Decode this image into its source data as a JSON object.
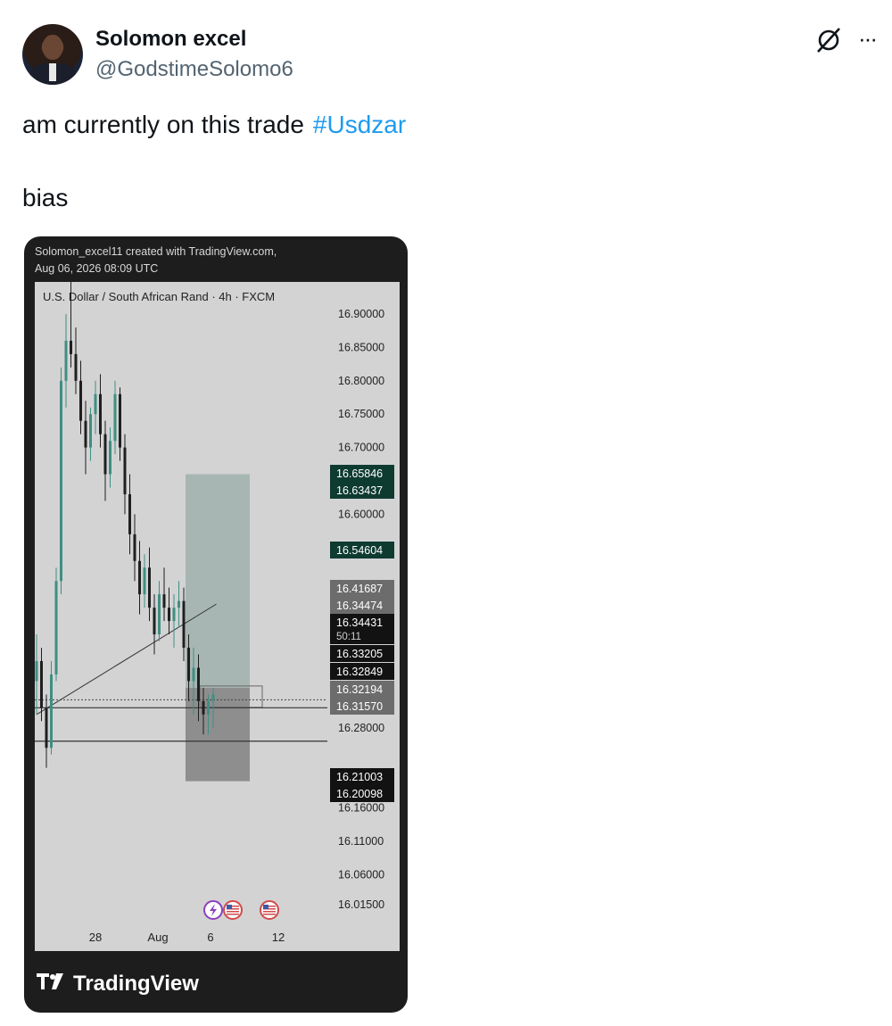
{
  "author": {
    "name": "Solomon excel",
    "handle": "@GodstimeSolomo6"
  },
  "tweet": {
    "text": "am currently on this trade",
    "hashtag": "#Usdzar",
    "second_line": "bias"
  },
  "icons": {
    "grok": "grok-icon",
    "more": "more-icon"
  },
  "chart_header": {
    "created_line": "Solomon_excel11 created with TradingView.com,",
    "date_line": "Aug 06, 2026 08:09 UTC",
    "symbol_line": "U.S. Dollar / South African Rand · 4h · FXCM"
  },
  "footer": {
    "brand": "TradingView"
  },
  "colors": {
    "accent": "#1d9bf0",
    "candle_up": "#3f8f82",
    "candle_down": "#1f1f1f",
    "label_green": "#0e3b30",
    "label_dark": "#121212",
    "label_gray": "#6c6c6c"
  },
  "chart_data": {
    "type": "candlestick",
    "title": "U.S. Dollar / South African Rand · 4h · FXCM",
    "x_ticks": [
      "28",
      "Aug",
      "6",
      "12"
    ],
    "y_ticks": [
      "16.90000",
      "16.85000",
      "16.80000",
      "16.75000",
      "16.70000",
      "16.60000",
      "16.28000",
      "16.16000",
      "16.11000",
      "16.06000",
      "16.01500"
    ],
    "ylim": [
      16.0,
      16.96
    ],
    "price_labels": [
      {
        "text": "16.65846",
        "value": 16.65846,
        "style": "green"
      },
      {
        "text": "16.63437",
        "value": 16.63437,
        "style": "green"
      },
      {
        "text": "16.54604",
        "value": 16.54604,
        "style": "green"
      },
      {
        "text": "16.41687",
        "value": 16.41687,
        "style": "gray"
      },
      {
        "text": "16.34474",
        "value": 16.34474,
        "style": "gray"
      },
      {
        "text": "16.34431",
        "value": 16.34431,
        "style": "dark",
        "sub": "50:11"
      },
      {
        "text": "16.33205",
        "value": 16.33205,
        "style": "dark"
      },
      {
        "text": "16.32849",
        "value": 16.32849,
        "style": "dark"
      },
      {
        "text": "16.32194",
        "value": 16.32194,
        "style": "gray"
      },
      {
        "text": "16.31570",
        "value": 16.3157,
        "style": "gray"
      },
      {
        "text": "16.21003",
        "value": 16.21003,
        "style": "dark"
      },
      {
        "text": "16.20098",
        "value": 16.20098,
        "style": "dark"
      }
    ],
    "position": {
      "entry": 16.34,
      "take_profit": 16.66,
      "stop_loss": 16.2
    },
    "candles": [
      [
        16.35,
        16.42,
        16.3,
        16.38
      ],
      [
        16.38,
        16.4,
        16.29,
        16.31
      ],
      [
        16.31,
        16.33,
        16.22,
        16.25
      ],
      [
        16.25,
        16.38,
        16.24,
        16.36
      ],
      [
        16.36,
        16.52,
        16.35,
        16.5
      ],
      [
        16.5,
        16.82,
        16.48,
        16.8
      ],
      [
        16.8,
        16.9,
        16.76,
        16.86
      ],
      [
        16.86,
        16.95,
        16.82,
        16.84
      ],
      [
        16.84,
        16.88,
        16.78,
        16.8
      ],
      [
        16.8,
        16.83,
        16.72,
        16.74
      ],
      [
        16.74,
        16.77,
        16.66,
        16.7
      ],
      [
        16.7,
        16.76,
        16.68,
        16.75
      ],
      [
        16.75,
        16.8,
        16.72,
        16.78
      ],
      [
        16.78,
        16.81,
        16.7,
        16.72
      ],
      [
        16.72,
        16.74,
        16.62,
        16.66
      ],
      [
        16.66,
        16.73,
        16.64,
        16.71
      ],
      [
        16.71,
        16.8,
        16.69,
        16.78
      ],
      [
        16.78,
        16.79,
        16.68,
        16.7
      ],
      [
        16.7,
        16.72,
        16.6,
        16.63
      ],
      [
        16.63,
        16.66,
        16.54,
        16.57
      ],
      [
        16.57,
        16.6,
        16.5,
        16.53
      ],
      [
        16.53,
        16.56,
        16.45,
        16.48
      ],
      [
        16.48,
        16.54,
        16.46,
        16.52
      ],
      [
        16.52,
        16.55,
        16.44,
        16.46
      ],
      [
        16.46,
        16.48,
        16.39,
        16.42
      ],
      [
        16.42,
        16.5,
        16.41,
        16.48
      ],
      [
        16.48,
        16.52,
        16.44,
        16.46
      ],
      [
        16.46,
        16.49,
        16.42,
        16.44
      ],
      [
        16.44,
        16.48,
        16.4,
        16.46
      ],
      [
        16.46,
        16.5,
        16.43,
        16.47
      ],
      [
        16.47,
        16.49,
        16.38,
        16.4
      ],
      [
        16.4,
        16.42,
        16.32,
        16.35
      ],
      [
        16.35,
        16.4,
        16.3,
        16.37
      ],
      [
        16.37,
        16.39,
        16.29,
        16.32
      ],
      [
        16.32,
        16.34,
        16.27,
        16.3
      ],
      [
        16.3,
        16.33,
        16.27,
        16.32
      ],
      [
        16.32,
        16.34,
        16.28,
        16.33
      ]
    ],
    "lines": [
      {
        "kind": "trendline",
        "from": {
          "index": 0,
          "value": 16.3
        },
        "to": {
          "index": 33,
          "value": 16.46
        }
      },
      {
        "kind": "horizontal",
        "value": 16.31
      },
      {
        "kind": "horizontal",
        "value": 16.26
      }
    ],
    "events": [
      "lightning",
      "us-flag",
      "us-flag"
    ]
  }
}
